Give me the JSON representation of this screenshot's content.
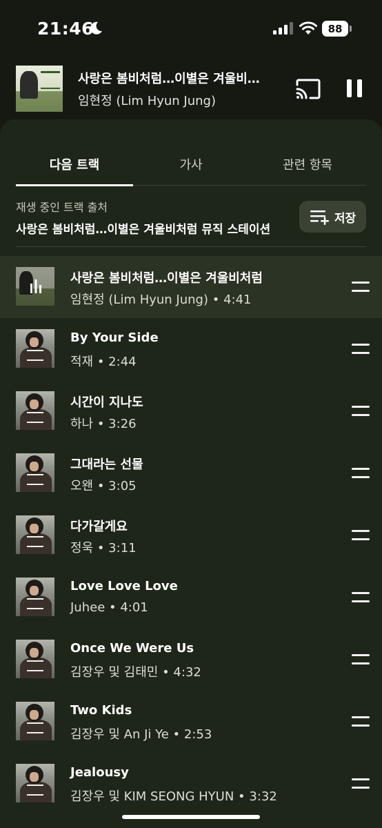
{
  "status": {
    "time": "21:46",
    "battery": "88"
  },
  "now_playing": {
    "title": "사랑은 봄비처럼…이별은 겨울비…",
    "artist": "임현정 (Lim Hyun Jung)"
  },
  "tabs": [
    {
      "label": "다음 트랙"
    },
    {
      "label": "가사"
    },
    {
      "label": "관련 항목"
    }
  ],
  "source": {
    "label": "재생 중인 트랙 출처",
    "name": "사랑은 봄비처럼…이별은 겨울비처럼 뮤직 스테이션",
    "save_label": "저장"
  },
  "queue": [
    {
      "title": "사랑은 봄비처럼…이별은 겨울비처럼",
      "meta": "임현정 (Lim Hyun Jung) • 4:41"
    },
    {
      "title": "By Your Side",
      "meta": "적재 • 2:44"
    },
    {
      "title": "시간이 지나도",
      "meta": "하나 • 3:26"
    },
    {
      "title": "그대라는 선물",
      "meta": "오왠 • 3:05"
    },
    {
      "title": "다가갈게요",
      "meta": "정욱 • 3:11"
    },
    {
      "title": "Love Love Love",
      "meta": "Juhee • 4:01"
    },
    {
      "title": "Once We Were Us",
      "meta": "김장우 및 김태민 • 4:32"
    },
    {
      "title": "Two Kids",
      "meta": "김장우 및 An Ji Ye • 2:53"
    },
    {
      "title": "Jealousy",
      "meta": "김장우 및 KIM SEONG HYUN • 3:32"
    }
  ],
  "colors": {
    "background": "#161912",
    "panel": "#1e2619",
    "playing_row": "#2b3324"
  },
  "icons": [
    "moon-icon",
    "signal-icon",
    "wifi-icon",
    "cast-icon",
    "pause-icon",
    "add-to-playlist-icon",
    "playing-bars-icon",
    "drag-handle-icon"
  ]
}
